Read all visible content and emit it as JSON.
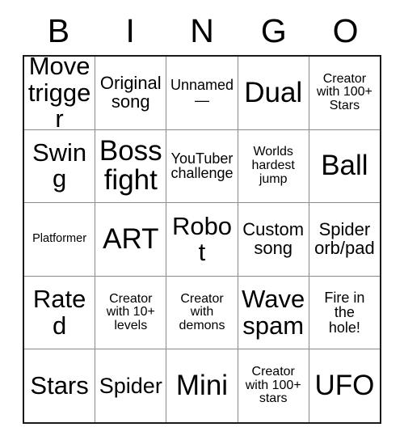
{
  "card": {
    "header": {
      "letters": [
        "B",
        "I",
        "N",
        "G",
        "O"
      ]
    },
    "rows": [
      [
        {
          "text": "Move\ntrigger",
          "size": "xl"
        },
        {
          "text": "Original\nsong",
          "size": "md"
        },
        {
          "text": "Unnamed\n—",
          "size": "sm"
        },
        {
          "text": "Dual",
          "size": "xxl"
        },
        {
          "text": "Creator\nwith 100+\nStars",
          "size": "xs"
        }
      ],
      [
        {
          "text": "Swing",
          "size": "xl"
        },
        {
          "text": "Boss\nfight",
          "size": "xxl"
        },
        {
          "text": "YouTuber\nchallenge",
          "size": "sm"
        },
        {
          "text": "Worlds\nhardest\njump",
          "size": "xs"
        },
        {
          "text": "Ball",
          "size": "xxl"
        }
      ],
      [
        {
          "text": "Platformer",
          "size": "xxs"
        },
        {
          "text": "ART",
          "size": "xxl"
        },
        {
          "text": "Robot",
          "size": "xl"
        },
        {
          "text": "Custom\nsong",
          "size": "md"
        },
        {
          "text": "Spider\norb/pad",
          "size": "md"
        }
      ],
      [
        {
          "text": "Rated",
          "size": "xl"
        },
        {
          "text": "Creator\nwith 10+\nlevels",
          "size": "xs"
        },
        {
          "text": "Creator\nwith\ndemons",
          "size": "xs"
        },
        {
          "text": "Wave\nspam",
          "size": "xl"
        },
        {
          "text": "Fire in\nthe\nhole!",
          "size": "sm"
        }
      ],
      [
        {
          "text": "Stars",
          "size": "xl"
        },
        {
          "text": "Spider",
          "size": "lg"
        },
        {
          "text": "Mini",
          "size": "xxl"
        },
        {
          "text": "Creator\nwith 100+\nstars",
          "size": "xs"
        },
        {
          "text": "UFO",
          "size": "xxl"
        }
      ]
    ]
  },
  "colors": {
    "background": "#ffffff",
    "text": "#000000",
    "outer_border": "#1a1a1a",
    "inner_border": "#8a8a8a"
  }
}
